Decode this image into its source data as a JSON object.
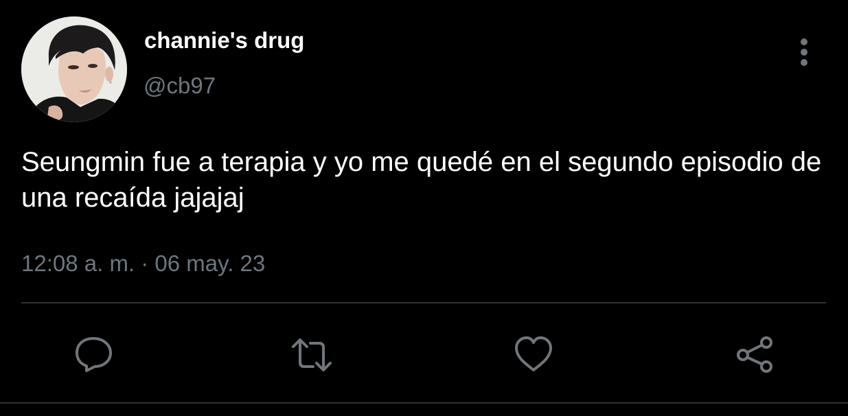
{
  "tweet": {
    "display_name": "channie's drug",
    "handle": "@cb97",
    "text": "Seungmin fue a terapia y yo me quedé en el segundo episodio de una recaída jajajaj",
    "timestamp": "12:08 a. m. · 06 may. 23"
  },
  "icons": {
    "more": "more-vertical-icon",
    "reply": "reply-icon",
    "retweet": "retweet-icon",
    "like": "heart-icon",
    "share": "share-icon"
  },
  "colors": {
    "background": "#000000",
    "primary_text": "#ffffff",
    "secondary_text": "#6e767d",
    "divider": "#2f3336",
    "icon": "#71767b"
  }
}
